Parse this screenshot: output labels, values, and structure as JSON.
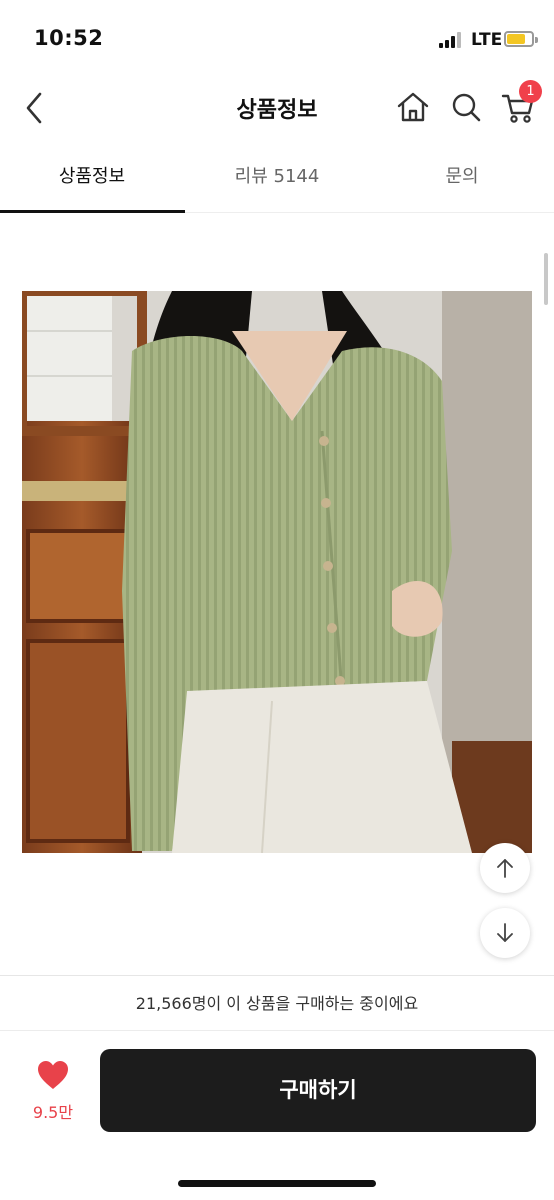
{
  "status_bar": {
    "time": "10:52",
    "network": "LTE"
  },
  "header": {
    "title": "상품정보",
    "cart_count": "1"
  },
  "tabs": [
    {
      "label": "상품정보",
      "active": true
    },
    {
      "label": "리뷰 5144",
      "active": false
    },
    {
      "label": "문의",
      "active": false
    }
  ],
  "product": {
    "image_desc": "woman in light green ribbed v-neck cardigan and white jeans"
  },
  "buyers": {
    "text": "21,566명이 이 상품을 구매하는 중이에요"
  },
  "actions": {
    "like_count": "9.5만",
    "buy_label": "구매하기"
  },
  "colors": {
    "accent": "#f0404b",
    "heart": "#e8424a",
    "buy_button": "#1c1c1c",
    "battery": "#f3c623"
  }
}
